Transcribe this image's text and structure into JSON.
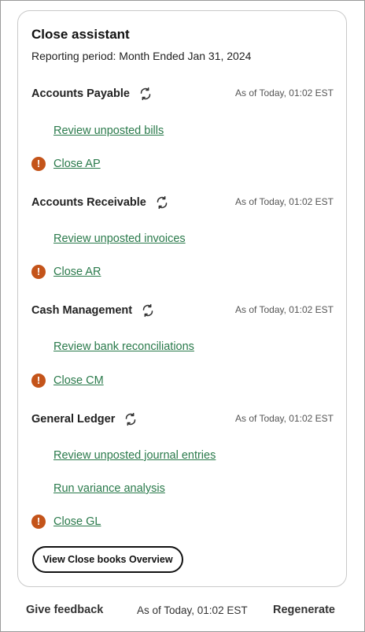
{
  "header": {
    "title": "Close assistant",
    "period": "Reporting period: Month Ended Jan 31, 2024"
  },
  "sections": [
    {
      "name": "Accounts Payable",
      "as_of": "As of Today, 01:02 EST",
      "links": [
        "Review unposted bills"
      ],
      "close_label": "Close AP"
    },
    {
      "name": "Accounts Receivable",
      "as_of": "As of Today, 01:02 EST",
      "links": [
        "Review unposted invoices"
      ],
      "close_label": "Close AR"
    },
    {
      "name": "Cash Management",
      "as_of": "As of Today, 01:02 EST",
      "links": [
        "Review bank reconciliations"
      ],
      "close_label": "Close CM"
    },
    {
      "name": "General Ledger",
      "as_of": "As of Today, 01:02 EST",
      "links": [
        "Review unposted journal entries",
        "Run variance analysis"
      ],
      "close_label": "Close GL"
    }
  ],
  "overview_button": "View Close books Overview",
  "footer": {
    "feedback": "Give feedback",
    "as_of": "As of Today, 01:02 EST",
    "regenerate": "Regenerate"
  },
  "icons": {
    "refresh": "refresh-icon",
    "warning": "exclamation-warning-icon"
  },
  "colors": {
    "link": "#2a7a4b",
    "warning": "#c4541a",
    "border": "#c9c9c9"
  }
}
